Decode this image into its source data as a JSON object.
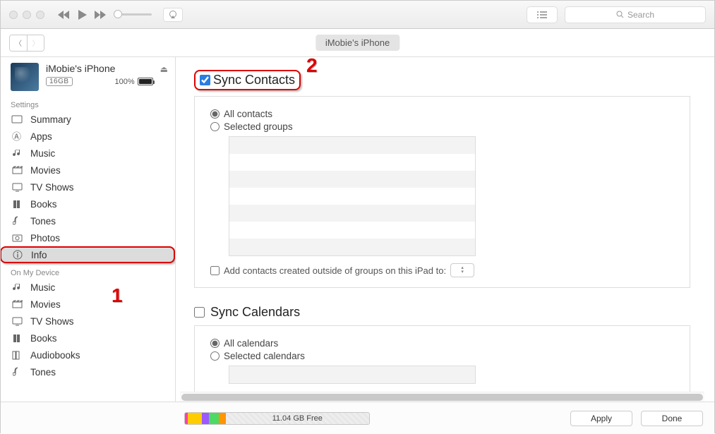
{
  "toolbar": {
    "search_placeholder": "Search"
  },
  "subbar": {
    "device_pill": "iMobie's iPhone"
  },
  "device": {
    "name": "iMobie's iPhone",
    "capacity": "16GB",
    "battery_pct": "100%"
  },
  "sidebar": {
    "settings_label": "Settings",
    "settings_items": [
      {
        "label": "Summary",
        "icon": "summary"
      },
      {
        "label": "Apps",
        "icon": "apps"
      },
      {
        "label": "Music",
        "icon": "music"
      },
      {
        "label": "Movies",
        "icon": "movies"
      },
      {
        "label": "TV Shows",
        "icon": "tv"
      },
      {
        "label": "Books",
        "icon": "books"
      },
      {
        "label": "Tones",
        "icon": "tones"
      },
      {
        "label": "Photos",
        "icon": "photos"
      },
      {
        "label": "Info",
        "icon": "info"
      }
    ],
    "device_label": "On My Device",
    "device_items": [
      {
        "label": "Music",
        "icon": "music"
      },
      {
        "label": "Movies",
        "icon": "movies"
      },
      {
        "label": "TV Shows",
        "icon": "tv"
      },
      {
        "label": "Books",
        "icon": "books"
      },
      {
        "label": "Audiobooks",
        "icon": "audiobooks"
      },
      {
        "label": "Tones",
        "icon": "tones"
      }
    ]
  },
  "contacts": {
    "title": "Sync Contacts",
    "checked": true,
    "all_label": "All contacts",
    "selected_label": "Selected groups",
    "outside_label": "Add contacts created outside of groups on this iPad to:"
  },
  "calendars": {
    "title": "Sync Calendars",
    "checked": false,
    "all_label": "All calendars",
    "selected_label": "Selected calendars"
  },
  "footer": {
    "free_text": "11.04 GB Free",
    "apply": "Apply",
    "done": "Done"
  },
  "annotations": {
    "step1": "1",
    "step2": "2"
  },
  "icons": {
    "summary": "▭",
    "apps": "⩍",
    "music": "♫",
    "movies": "🎬",
    "tv": "▢",
    "books": "▮▮",
    "tones": "♩",
    "photos": "◎",
    "info": "ⓘ",
    "audiobooks": "▯▯"
  }
}
